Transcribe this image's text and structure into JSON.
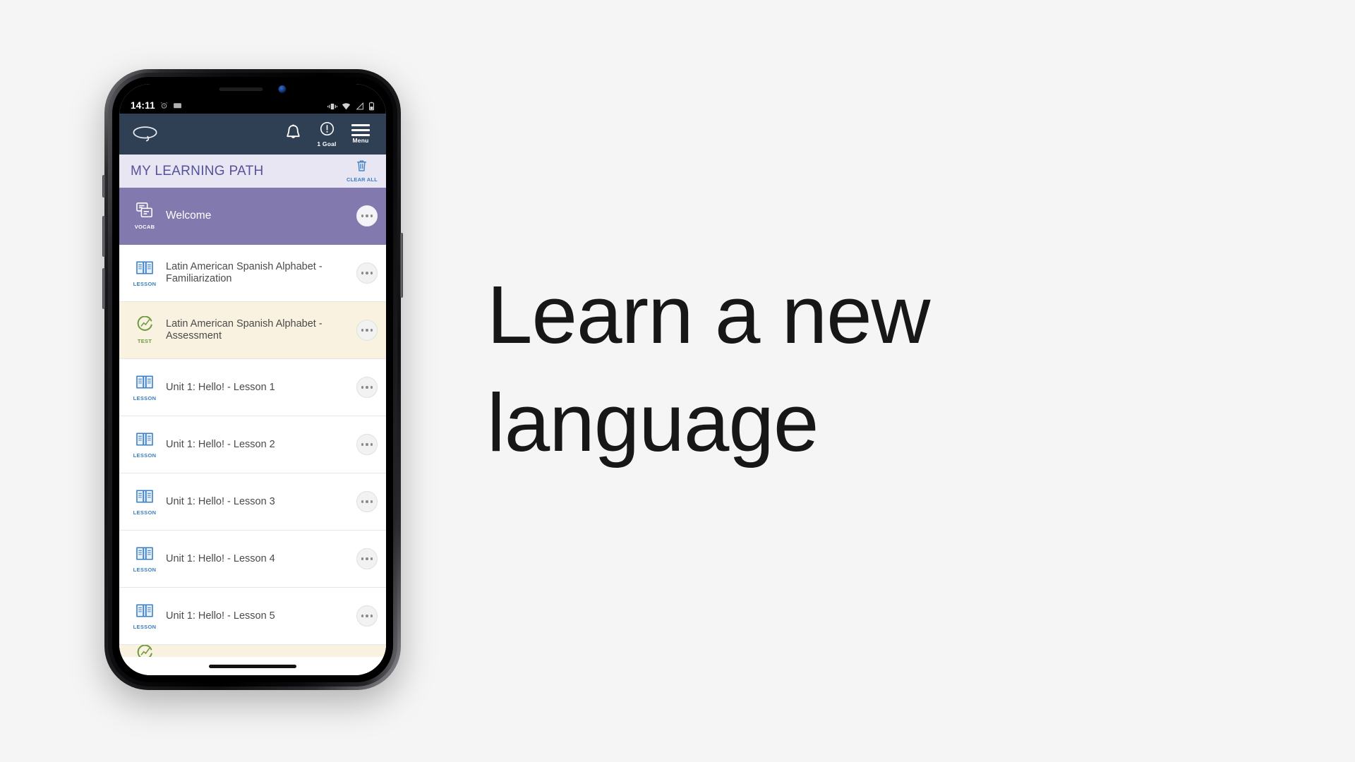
{
  "headline": "Learn a new language",
  "phone": {
    "status_bar": {
      "time": "14:11",
      "icons": [
        "alarm-icon",
        "screenshot-icon",
        "vibrate-icon",
        "wifi-icon",
        "signal-icon",
        "battery-icon"
      ]
    },
    "app_header": {
      "logo": "rosetta-stone-logo",
      "notifications_icon": "bell-icon",
      "goal_icon": "goal-alert-icon",
      "goal_label": "1 Goal",
      "menu_icon": "hamburger-icon",
      "menu_label": "Menu"
    },
    "path_header": {
      "title": "MY LEARNING PATH",
      "clear_all_icon": "trash-icon",
      "clear_all_label": "CLEAR ALL"
    },
    "rows": [
      {
        "tag": "VOCAB",
        "icon": "vocab-cards-icon",
        "title": "Welcome",
        "state": "active",
        "menu": "overflow-menu-icon"
      },
      {
        "tag": "LESSON",
        "icon": "open-book-icon",
        "title": "Latin American Spanish Alphabet - Familiarization",
        "state": "normal",
        "menu": "overflow-menu-icon"
      },
      {
        "tag": "TEST",
        "icon": "assessment-icon",
        "title": "Latin American Spanish Alphabet - Assessment",
        "state": "test",
        "menu": "overflow-menu-icon"
      },
      {
        "tag": "LESSON",
        "icon": "open-book-icon",
        "title": "Unit 1: Hello! - Lesson 1",
        "state": "normal",
        "menu": "overflow-menu-icon"
      },
      {
        "tag": "LESSON",
        "icon": "open-book-icon",
        "title": "Unit 1: Hello! - Lesson 2",
        "state": "normal",
        "menu": "overflow-menu-icon"
      },
      {
        "tag": "LESSON",
        "icon": "open-book-icon",
        "title": "Unit 1: Hello! - Lesson 3",
        "state": "normal",
        "menu": "overflow-menu-icon"
      },
      {
        "tag": "LESSON",
        "icon": "open-book-icon",
        "title": "Unit 1: Hello! - Lesson 4",
        "state": "normal",
        "menu": "overflow-menu-icon"
      },
      {
        "tag": "LESSON",
        "icon": "open-book-icon",
        "title": "Unit 1: Hello! - Lesson 5",
        "state": "normal",
        "menu": "overflow-menu-icon"
      }
    ]
  },
  "colors": {
    "page_bg": "#f5f5f5",
    "header_bar": "#2f4055",
    "path_title_bg": "#e8e6f2",
    "path_title_text": "#55519a",
    "active_row": "#8279ae",
    "test_row": "#faf2e0",
    "accent_blue": "#3b7fc4",
    "test_green": "#6f9b3f"
  }
}
